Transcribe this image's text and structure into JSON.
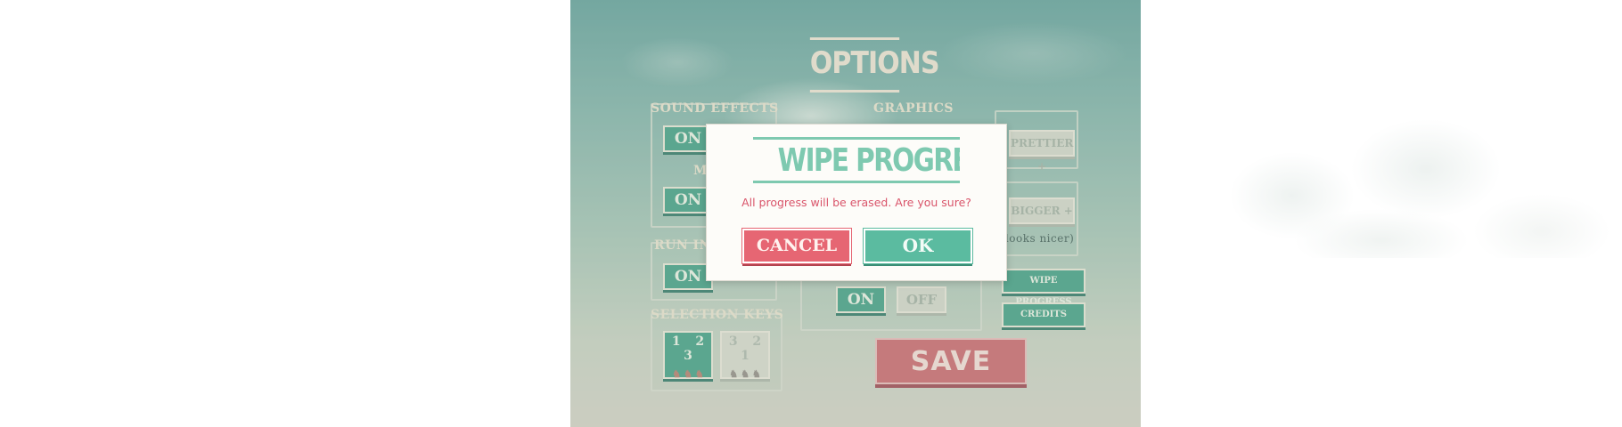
{
  "options_screen": {
    "title": "OPTIONS",
    "sound_effects": {
      "label": "SOUND EFFECTS",
      "on_label": "ON"
    },
    "music": {
      "label": "M",
      "on_label": "ON"
    },
    "run_in": {
      "label": "RUN IN",
      "on_label": "ON"
    },
    "selection_keys": {
      "label": "SELECTION KEYS",
      "option_a": {
        "numbers": "1 2 3"
      },
      "option_b": {
        "numbers": "3 2 1"
      }
    },
    "graphics": {
      "label": "GRAPHICS",
      "prettier_label": "PRETTIER +"
    },
    "size": {
      "bigger_label": "BIGGER +",
      "note": "(looks nicer)"
    },
    "toggle": {
      "on_label": "ON",
      "off_label": "OFF"
    },
    "wipe_progress_label": "WIPE PROGRESS",
    "credits_label": "CREDITS",
    "save_label": "SAVE"
  },
  "dialog": {
    "title": "WIPE PROGRESS",
    "message": "All progress will be erased. Are you sure?",
    "cancel_label": "CANCEL",
    "ok_label": "OK"
  },
  "colors": {
    "dialog_title": "#7ec9b0",
    "message": "#d9546a",
    "cancel": "#e66673",
    "ok": "#5bbba0",
    "save": "#c7646a",
    "green_button": "#3f9d82"
  }
}
